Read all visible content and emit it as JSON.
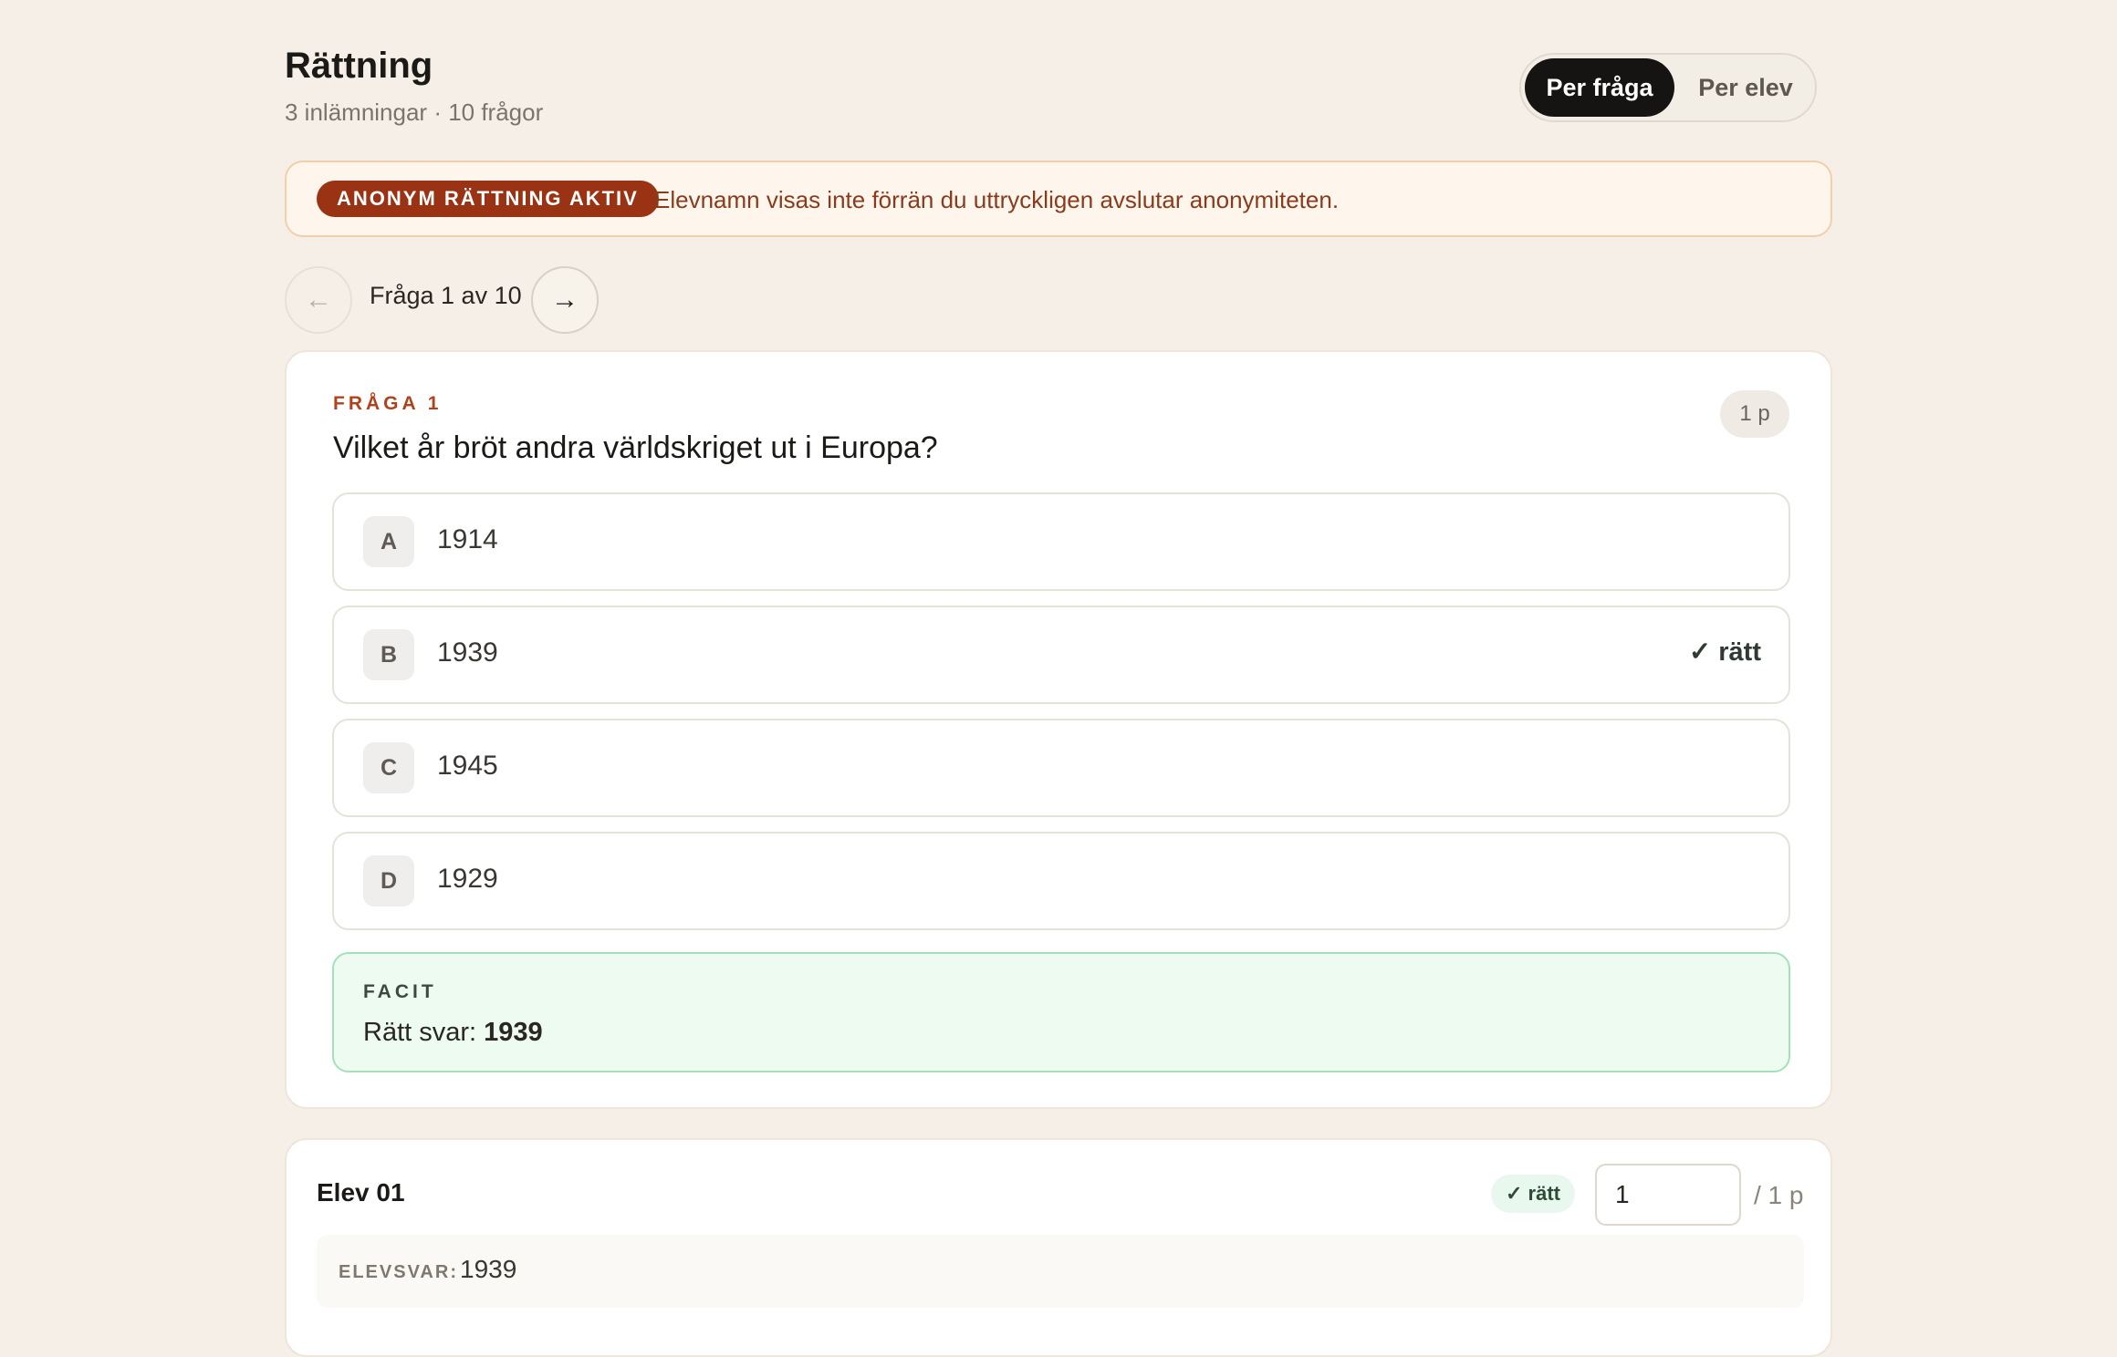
{
  "header": {
    "title": "Rättning",
    "subtitle": "3 inlämningar · 10 frågor"
  },
  "view_toggle": {
    "active": "Per fråga",
    "inactive": "Per elev"
  },
  "banner": {
    "badge": "ANONYM RÄTTNING AKTIV",
    "text": "Elevnamn visas inte förrän du uttryckligen avslutar anonymiteten."
  },
  "nav": {
    "prev_icon": "arrow-left-icon",
    "label": "Fråga 1 av 10",
    "next_icon": "arrow-right-icon"
  },
  "question": {
    "kicker": "FRÅGA 1",
    "text": "Vilket år bröt andra världskriget ut i Europa?",
    "points": "1 p",
    "options": [
      {
        "letter": "A",
        "value": "1914",
        "mark": ""
      },
      {
        "letter": "B",
        "value": "1939",
        "mark": "✓ rätt"
      },
      {
        "letter": "C",
        "value": "1945",
        "mark": ""
      },
      {
        "letter": "D",
        "value": "1929",
        "mark": ""
      }
    ],
    "facit": {
      "label": "FACIT",
      "prefix": "Rätt svar:",
      "answer": "1939"
    }
  },
  "student": {
    "name": "Elev 01",
    "status": "✓ rätt",
    "score": "1",
    "max": "/ 1 p",
    "answer_label": "ELEVSVAR:",
    "answer_value": "1939"
  },
  "colors": {
    "background": "#f5efe7",
    "accent": "#9a3214",
    "correct": "#edfbf1",
    "dark": "#161412"
  }
}
